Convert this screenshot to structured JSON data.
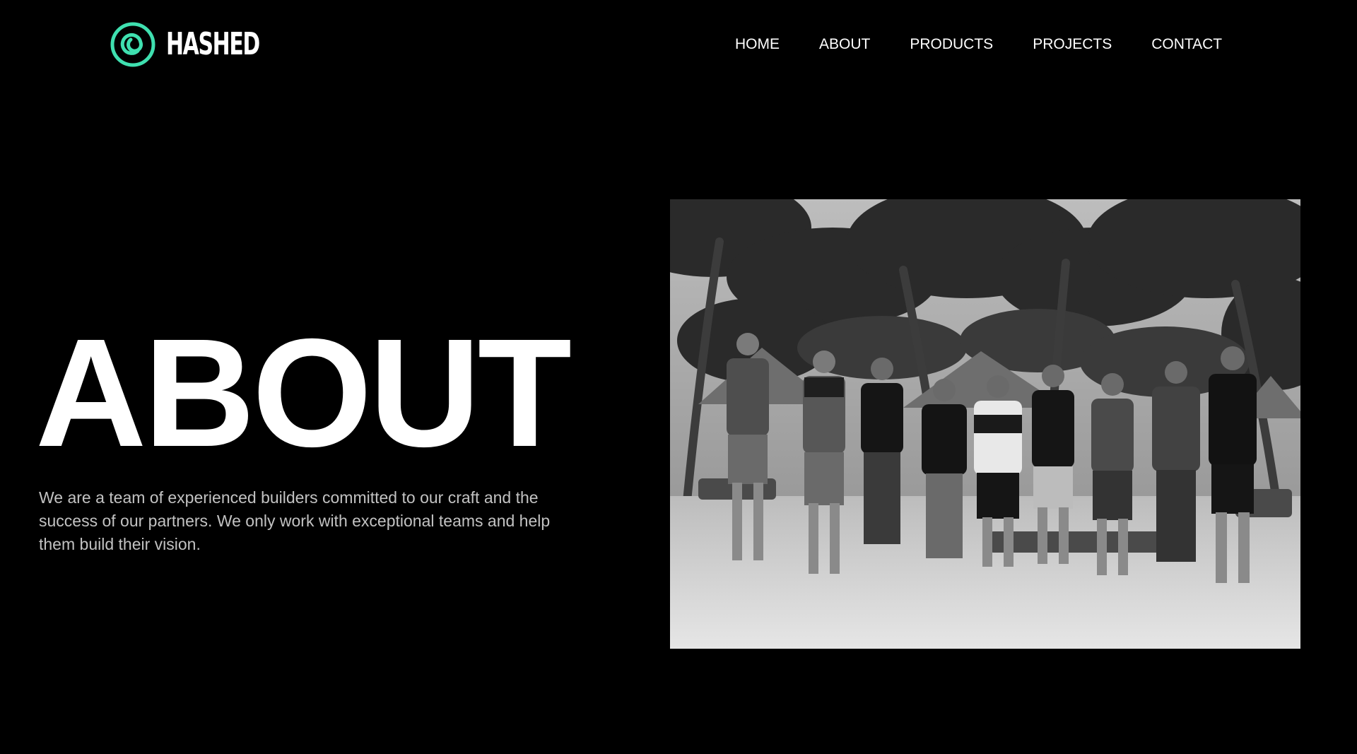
{
  "brand": {
    "name": "HASHED",
    "logo_icon": "spiral-circle-logo-icon",
    "accent_color": "#3fe0b0"
  },
  "nav": {
    "items": [
      {
        "label": "HOME"
      },
      {
        "label": "ABOUT"
      },
      {
        "label": "PRODUCTS"
      },
      {
        "label": "PROJECTS"
      },
      {
        "label": "CONTACT"
      }
    ]
  },
  "hero": {
    "title": "ABOUT",
    "description": "We are a team of experienced builders committed to our craft and the success of our partners. We only work with exceptional teams and help them build their vision."
  },
  "photo": {
    "subject": "team-photo",
    "style": "black-and-white"
  },
  "colors": {
    "background": "#000000",
    "text_primary": "#ffffff",
    "text_secondary": "#c2c2c2"
  }
}
